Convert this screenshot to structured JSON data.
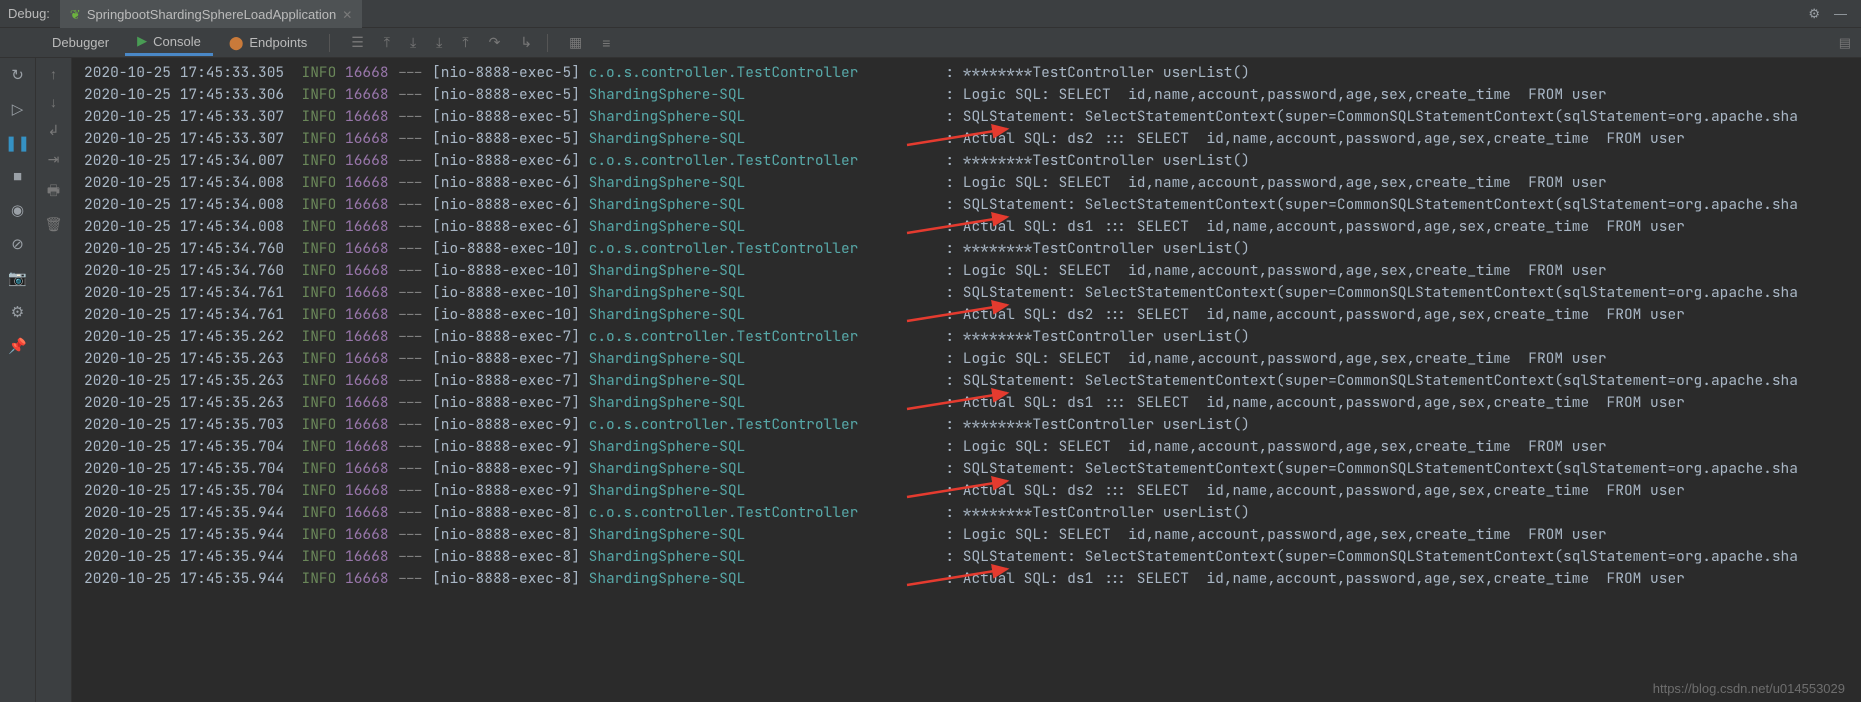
{
  "top": {
    "label": "Debug:",
    "tab_title": "SpringbootShardingSphereLoadApplication"
  },
  "panel_tabs": {
    "debugger": "Debugger",
    "console": "Console",
    "endpoints": "Endpoints"
  },
  "watermark": "https://blog.csdn.net/u014553029",
  "logs": [
    {
      "ts": "2020-10-25 17:45:33.305",
      "lvl": "INFO",
      "pid": "16668",
      "thread": "[nio-8888-exec-5]",
      "logger": "c.o.s.controller.TestController",
      "msg": "********TestController userList()"
    },
    {
      "ts": "2020-10-25 17:45:33.306",
      "lvl": "INFO",
      "pid": "16668",
      "thread": "[nio-8888-exec-5]",
      "logger": "ShardingSphere-SQL",
      "msg": "Logic SQL: SELECT  id,name,account,password,age,sex,create_time  FROM user"
    },
    {
      "ts": "2020-10-25 17:45:33.307",
      "lvl": "INFO",
      "pid": "16668",
      "thread": "[nio-8888-exec-5]",
      "logger": "ShardingSphere-SQL",
      "msg": "SQLStatement: SelectStatementContext(super=CommonSQLStatementContext(sqlStatement=org.apache.sha"
    },
    {
      "ts": "2020-10-25 17:45:33.307",
      "lvl": "INFO",
      "pid": "16668",
      "thread": "[nio-8888-exec-5]",
      "logger": "ShardingSphere-SQL",
      "msg": "Actual SQL: ds2 ::: SELECT  id,name,account,password,age,sex,create_time  FROM user"
    },
    {
      "ts": "2020-10-25 17:45:34.007",
      "lvl": "INFO",
      "pid": "16668",
      "thread": "[nio-8888-exec-6]",
      "logger": "c.o.s.controller.TestController",
      "msg": "********TestController userList()"
    },
    {
      "ts": "2020-10-25 17:45:34.008",
      "lvl": "INFO",
      "pid": "16668",
      "thread": "[nio-8888-exec-6]",
      "logger": "ShardingSphere-SQL",
      "msg": "Logic SQL: SELECT  id,name,account,password,age,sex,create_time  FROM user"
    },
    {
      "ts": "2020-10-25 17:45:34.008",
      "lvl": "INFO",
      "pid": "16668",
      "thread": "[nio-8888-exec-6]",
      "logger": "ShardingSphere-SQL",
      "msg": "SQLStatement: SelectStatementContext(super=CommonSQLStatementContext(sqlStatement=org.apache.sha"
    },
    {
      "ts": "2020-10-25 17:45:34.008",
      "lvl": "INFO",
      "pid": "16668",
      "thread": "[nio-8888-exec-6]",
      "logger": "ShardingSphere-SQL",
      "msg": "Actual SQL: ds1 ::: SELECT  id,name,account,password,age,sex,create_time  FROM user"
    },
    {
      "ts": "2020-10-25 17:45:34.760",
      "lvl": "INFO",
      "pid": "16668",
      "thread": "[io-8888-exec-10]",
      "logger": "c.o.s.controller.TestController",
      "msg": "********TestController userList()"
    },
    {
      "ts": "2020-10-25 17:45:34.760",
      "lvl": "INFO",
      "pid": "16668",
      "thread": "[io-8888-exec-10]",
      "logger": "ShardingSphere-SQL",
      "msg": "Logic SQL: SELECT  id,name,account,password,age,sex,create_time  FROM user"
    },
    {
      "ts": "2020-10-25 17:45:34.761",
      "lvl": "INFO",
      "pid": "16668",
      "thread": "[io-8888-exec-10]",
      "logger": "ShardingSphere-SQL",
      "msg": "SQLStatement: SelectStatementContext(super=CommonSQLStatementContext(sqlStatement=org.apache.sha"
    },
    {
      "ts": "2020-10-25 17:45:34.761",
      "lvl": "INFO",
      "pid": "16668",
      "thread": "[io-8888-exec-10]",
      "logger": "ShardingSphere-SQL",
      "msg": "Actual SQL: ds2 ::: SELECT  id,name,account,password,age,sex,create_time  FROM user"
    },
    {
      "ts": "2020-10-25 17:45:35.262",
      "lvl": "INFO",
      "pid": "16668",
      "thread": "[nio-8888-exec-7]",
      "logger": "c.o.s.controller.TestController",
      "msg": "********TestController userList()"
    },
    {
      "ts": "2020-10-25 17:45:35.263",
      "lvl": "INFO",
      "pid": "16668",
      "thread": "[nio-8888-exec-7]",
      "logger": "ShardingSphere-SQL",
      "msg": "Logic SQL: SELECT  id,name,account,password,age,sex,create_time  FROM user"
    },
    {
      "ts": "2020-10-25 17:45:35.263",
      "lvl": "INFO",
      "pid": "16668",
      "thread": "[nio-8888-exec-7]",
      "logger": "ShardingSphere-SQL",
      "msg": "SQLStatement: SelectStatementContext(super=CommonSQLStatementContext(sqlStatement=org.apache.sha"
    },
    {
      "ts": "2020-10-25 17:45:35.263",
      "lvl": "INFO",
      "pid": "16668",
      "thread": "[nio-8888-exec-7]",
      "logger": "ShardingSphere-SQL",
      "msg": "Actual SQL: ds1 ::: SELECT  id,name,account,password,age,sex,create_time  FROM user"
    },
    {
      "ts": "2020-10-25 17:45:35.703",
      "lvl": "INFO",
      "pid": "16668",
      "thread": "[nio-8888-exec-9]",
      "logger": "c.o.s.controller.TestController",
      "msg": "********TestController userList()"
    },
    {
      "ts": "2020-10-25 17:45:35.704",
      "lvl": "INFO",
      "pid": "16668",
      "thread": "[nio-8888-exec-9]",
      "logger": "ShardingSphere-SQL",
      "msg": "Logic SQL: SELECT  id,name,account,password,age,sex,create_time  FROM user"
    },
    {
      "ts": "2020-10-25 17:45:35.704",
      "lvl": "INFO",
      "pid": "16668",
      "thread": "[nio-8888-exec-9]",
      "logger": "ShardingSphere-SQL",
      "msg": "SQLStatement: SelectStatementContext(super=CommonSQLStatementContext(sqlStatement=org.apache.sha"
    },
    {
      "ts": "2020-10-25 17:45:35.704",
      "lvl": "INFO",
      "pid": "16668",
      "thread": "[nio-8888-exec-9]",
      "logger": "ShardingSphere-SQL",
      "msg": "Actual SQL: ds2 ::: SELECT  id,name,account,password,age,sex,create_time  FROM user"
    },
    {
      "ts": "2020-10-25 17:45:35.944",
      "lvl": "INFO",
      "pid": "16668",
      "thread": "[nio-8888-exec-8]",
      "logger": "c.o.s.controller.TestController",
      "msg": "********TestController userList()"
    },
    {
      "ts": "2020-10-25 17:45:35.944",
      "lvl": "INFO",
      "pid": "16668",
      "thread": "[nio-8888-exec-8]",
      "logger": "ShardingSphere-SQL",
      "msg": "Logic SQL: SELECT  id,name,account,password,age,sex,create_time  FROM user"
    },
    {
      "ts": "2020-10-25 17:45:35.944",
      "lvl": "INFO",
      "pid": "16668",
      "thread": "[nio-8888-exec-8]",
      "logger": "ShardingSphere-SQL",
      "msg": "SQLStatement: SelectStatementContext(super=CommonSQLStatementContext(sqlStatement=org.apache.sha"
    },
    {
      "ts": "2020-10-25 17:45:35.944",
      "lvl": "INFO",
      "pid": "16668",
      "thread": "[nio-8888-exec-8]",
      "logger": "ShardingSphere-SQL",
      "msg": "Actual SQL: ds1 ::: SELECT  id,name,account,password,age,sex,create_time  FROM user"
    }
  ],
  "arrows_at_lines": [
    3,
    7,
    11,
    15,
    19,
    23
  ]
}
